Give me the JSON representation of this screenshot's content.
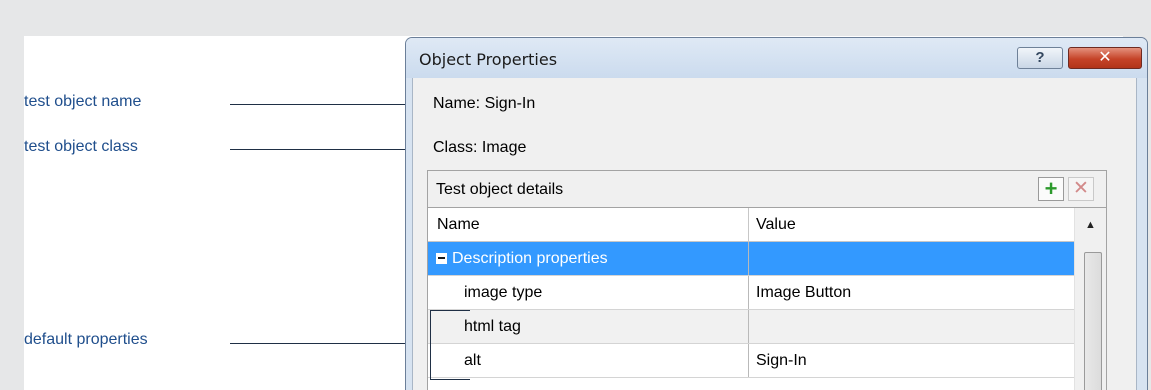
{
  "callouts": {
    "test_object_name": "test object name",
    "test_object_class": "test object class",
    "default_properties": "default properties"
  },
  "dialog": {
    "title": "Object Properties",
    "help_glyph": "?",
    "close_glyph": "✕",
    "name_field": "Name:  Sign-In",
    "class_field": "Class:  Image"
  },
  "details": {
    "panel_title": "Test object details",
    "add_glyph": "+",
    "delete_glyph": "✕",
    "columns": [
      "Name",
      "Value"
    ],
    "group_label": "Description properties",
    "rows": [
      {
        "name": "image type",
        "value": "Image Button"
      },
      {
        "name": "html tag",
        "value": ""
      },
      {
        "name": "alt",
        "value": "Sign-In"
      }
    ]
  },
  "scrollbar": {
    "up_glyph": "▲"
  },
  "icons": [
    "help-icon",
    "close-icon",
    "add-icon",
    "delete-icon",
    "collapse-icon",
    "scroll-up-icon"
  ],
  "colors": {
    "selection": "#3399ff",
    "callout_text": "#1f4e8c",
    "close_button": "#c54328"
  }
}
